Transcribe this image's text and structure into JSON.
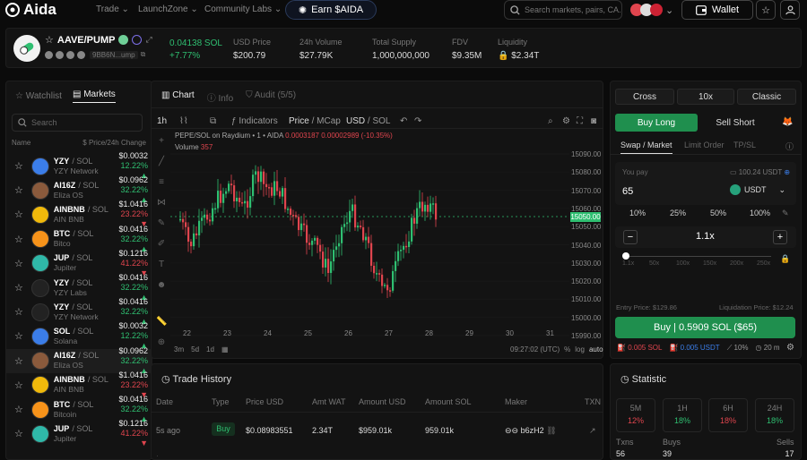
{
  "brand": {
    "name": "Aida"
  },
  "nav": {
    "items": [
      "Trade",
      "LaunchZone",
      "Community Labs"
    ],
    "earn": "Earn $AIDA"
  },
  "search": {
    "placeholder": "Search markets, pairs, CA..."
  },
  "wallet": {
    "label": "Wallet"
  },
  "token": {
    "name": "AAVE/PUMP",
    "address": "9BB6N...ump",
    "price_sol": "0.04138 SOL",
    "change": "+7.77%",
    "stats": [
      {
        "label": "USD Price",
        "value": "$200.79"
      },
      {
        "label": "24h Volume",
        "value": "$27.79K"
      },
      {
        "label": "Total Supply",
        "value": "1,000,000,000"
      },
      {
        "label": "FDV",
        "value": "$9.35M"
      },
      {
        "label": "Liquidity",
        "value": "$2.34T"
      }
    ]
  },
  "watchlist": {
    "tabs": [
      "Watchlist",
      "Markets"
    ],
    "search_placeholder": "Search",
    "col_name": "Name",
    "col_price": "$ Price/24h Change",
    "rows": [
      {
        "sym": "YZY",
        "quote": "/ SOL",
        "sub": "YZY Network",
        "price": "$0.0032",
        "chg": "12.22%",
        "dir": "up",
        "icon": "#3b7de8"
      },
      {
        "sym": "AI16Z",
        "quote": "/ SOL",
        "sub": "Eliza OS",
        "price": "$0.0962",
        "chg": "32.22%",
        "dir": "up",
        "icon": "#8a5a3c"
      },
      {
        "sym": "AINBNB",
        "quote": "/ SOL",
        "sub": "AIN BNB",
        "price": "$1.0416",
        "chg": "23.22%",
        "dir": "down",
        "icon": "#f0b90b"
      },
      {
        "sym": "BTC",
        "quote": "/ SOL",
        "sub": "Bitco",
        "price": "$0.0416",
        "chg": "32.22%",
        "dir": "up",
        "icon": "#f7931a"
      },
      {
        "sym": "JUP",
        "quote": "/ SOL",
        "sub": "Jupiter",
        "price": "$0.1216",
        "chg": "41.22%",
        "dir": "down",
        "icon": "#2fb8a8"
      },
      {
        "sym": "YZY",
        "quote": "/ SOL",
        "sub": "YZY Labs",
        "price": "$0.0416",
        "chg": "32.22%",
        "dir": "up",
        "icon": "#222"
      },
      {
        "sym": "YZY",
        "quote": "/ SOL",
        "sub": "YZY Network",
        "price": "$0.0416",
        "chg": "32.22%",
        "dir": "up",
        "icon": "#222"
      },
      {
        "sym": "SOL",
        "quote": "/ SOL",
        "sub": "Solana",
        "price": "$0.0032",
        "chg": "12.22%",
        "dir": "up",
        "icon": "#3b7de8"
      },
      {
        "sym": "AI16Z",
        "quote": "/ SOL",
        "sub": "Eliza OS",
        "price": "$0.0962",
        "chg": "32.22%",
        "dir": "up",
        "icon": "#8a5a3c"
      },
      {
        "sym": "AINBNB",
        "quote": "/ SOL",
        "sub": "AIN BNB",
        "price": "$1.0416",
        "chg": "23.22%",
        "dir": "down",
        "icon": "#f0b90b"
      },
      {
        "sym": "BTC",
        "quote": "/ SOL",
        "sub": "Bitcoin",
        "price": "$0.0416",
        "chg": "32.22%",
        "dir": "up",
        "icon": "#f7931a"
      },
      {
        "sym": "JUP",
        "quote": "/ SOL",
        "sub": "Jupiter",
        "price": "$0.1216",
        "chg": "41.22%",
        "dir": "down",
        "icon": "#2fb8a8"
      }
    ]
  },
  "chart_tabs": {
    "chart": "Chart",
    "info": "Info",
    "audit": "Audit (5/5)"
  },
  "chart_toolbar": {
    "interval": "1h",
    "indicators": "Indicators",
    "price": "Price",
    "mcap": "MCap",
    "usd": "USD",
    "sol": "SOL"
  },
  "chart_legend": {
    "pair": "PEPE/SOL on Raydium • 1 • AIDA",
    "ohlc": "0.0003187 0.00002989 (-10.35%)",
    "volume_label": "Volume",
    "volume_value": "357"
  },
  "chart_data": {
    "type": "candlestick",
    "x_ticks": [
      "22",
      "23",
      "24",
      "25",
      "26",
      "27",
      "28",
      "29",
      "30",
      "31"
    ],
    "y_ticks": [
      "15090.00",
      "15080.00",
      "15070.00",
      "15060.00",
      "15050.00",
      "15040.00",
      "15030.00",
      "15020.00",
      "15010.00",
      "15000.00",
      "15990.00"
    ],
    "last_price_label": "15050.00",
    "ylim": [
      14990,
      15090
    ]
  },
  "chart_bottom": {
    "ranges": [
      "3m",
      "5d",
      "1d"
    ],
    "time": "09:27:02 (UTC)",
    "pct": "%",
    "log": "log",
    "auto": "auto"
  },
  "trade_history": {
    "title": "Trade History",
    "cols": [
      "Date",
      "Type",
      "Price USD",
      "Amt WAT",
      "Amount USD",
      "Amount SOL",
      "Maker",
      "TXN"
    ],
    "rows": [
      {
        "date": "5s ago",
        "type": "Buy",
        "price": "$0.08983551",
        "amt": "2.34T",
        "usd": "$959.01k",
        "sol": "959.01k",
        "maker": "b6zH2"
      }
    ]
  },
  "trade": {
    "modes": [
      "Cross",
      "10x",
      "Classic"
    ],
    "long": "Buy Long",
    "short": "Sell Short",
    "tabs": [
      "Swap / Market",
      "Limit Order",
      "TP/SL"
    ],
    "you_pay": "You pay",
    "balance": "100.24 USDT",
    "amount": "65",
    "currency": "USDT",
    "pcts": [
      "10%",
      "25%",
      "50%",
      "100%"
    ],
    "leverage": "1.1x",
    "lev_ticks": [
      "1.1x",
      "50x",
      "100x",
      "150x",
      "200x",
      "250x"
    ],
    "entry_label": "Entry Price:",
    "entry_value": "$129.86",
    "liq_label": "Liquidation Price:",
    "liq_value": "$12.24",
    "buy_button": "Buy | 0.5909 SOL ($65)",
    "fees": [
      "0.005 SOL",
      "0.005 USDT",
      "10%",
      "20 m"
    ]
  },
  "statistic": {
    "title": "Statistic",
    "timeframes": [
      {
        "label": "5M",
        "value": "12%"
      },
      {
        "label": "1H",
        "value": "18%"
      },
      {
        "label": "6H",
        "value": "18%"
      },
      {
        "label": "24H",
        "value": "18%"
      }
    ],
    "txns_label": "Txns",
    "txns": "56",
    "buys_label": "Buys",
    "buys": "39",
    "sells_label": "Sells",
    "sells": "17"
  },
  "colors": {
    "green": "#2fbf71",
    "red": "#e0454e",
    "accent": "#1f8f4e"
  }
}
